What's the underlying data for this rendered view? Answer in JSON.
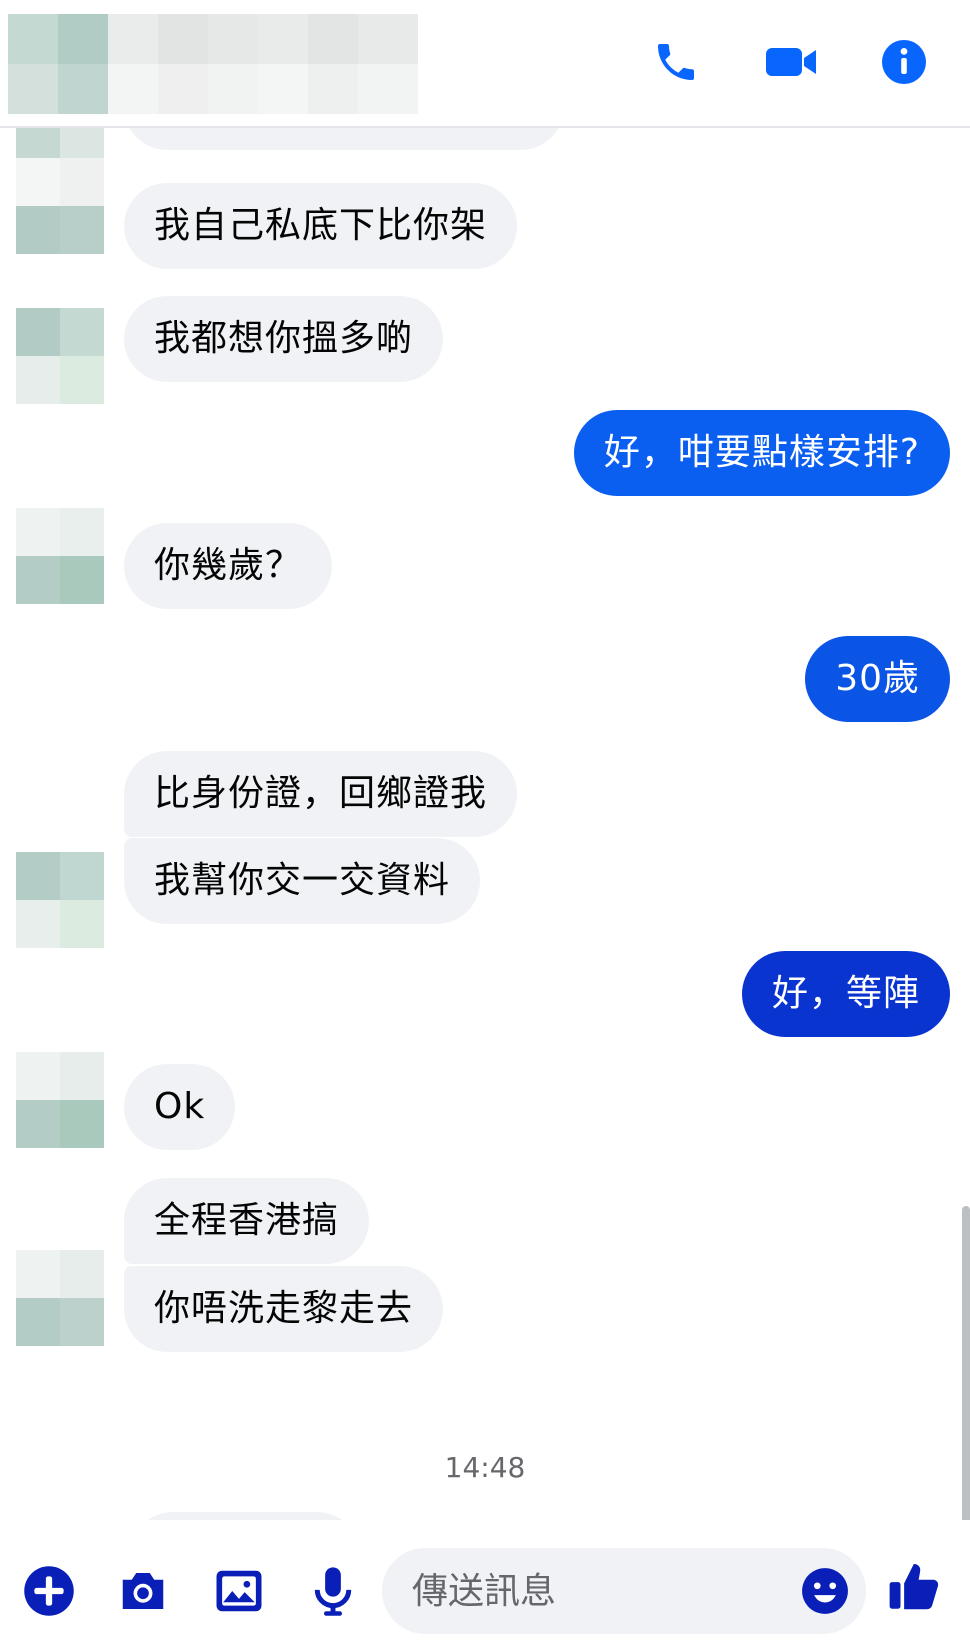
{
  "header": {
    "contact_name": "",
    "icons": [
      "phone-icon",
      "video-call-icon",
      "info-icon"
    ]
  },
  "messages": [
    {
      "side": "in",
      "text": "我自己私底下比你架"
    },
    {
      "side": "in",
      "text": "我都想你搵多啲"
    },
    {
      "side": "out",
      "text": "好，咁要點樣安排?"
    },
    {
      "side": "in",
      "text": "你幾歲？"
    },
    {
      "side": "out",
      "text": "30歲"
    },
    {
      "side": "in",
      "text": "比身份證，回鄉證我"
    },
    {
      "side": "in",
      "text": "我幫你交一交資料"
    },
    {
      "side": "out",
      "text": "好，等陣"
    },
    {
      "side": "in",
      "text": "Ok"
    },
    {
      "side": "in",
      "text": "全程香港搞"
    },
    {
      "side": "in",
      "text": "你唔洗走黎走去"
    }
  ],
  "timestamp": "14:48",
  "composer": {
    "placeholder": "傳送訊息",
    "icons": [
      "plus-icon",
      "camera-icon",
      "gallery-icon",
      "microphone-icon",
      "emoji-icon",
      "thumbs-up-icon"
    ]
  },
  "colors": {
    "accent": "#0866ff",
    "composer_icon": "#0a1fb8",
    "incoming_bubble": "#f0f2f5",
    "outgoing_top": "#0b5ff0",
    "outgoing_bottom": "#1526c8"
  }
}
